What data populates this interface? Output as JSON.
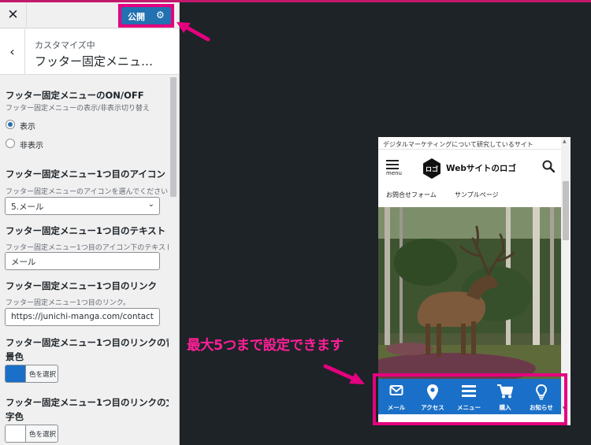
{
  "header": {
    "close_icon": "close-icon",
    "publish_label": "公開",
    "publish_gear_icon": "gear-icon"
  },
  "title_bar": {
    "subtitle": "カスタマイズ中",
    "title": "フッター固定メニュ…"
  },
  "sections": {
    "onoff": {
      "title": "フッター固定メニューのON/OFF",
      "desc": "フッター固定メニューの表示/非表示切り替え",
      "options": [
        {
          "label": "表示",
          "checked": true
        },
        {
          "label": "非表示",
          "checked": false
        }
      ]
    },
    "icon": {
      "title": "フッター固定メニュー1つ目のアイコン",
      "desc": "フッター固定メニューのアイコンを選んでください",
      "value": "5.メール"
    },
    "text": {
      "title": "フッター固定メニュー1つ目のテキスト",
      "desc": "フッター固定メニュー1つ目のアイコン下のテキスト。",
      "value": "メール"
    },
    "link": {
      "title": "フッター固定メニュー1つ目のリンク",
      "desc": "フッター固定メニュー1つ目のリンク。",
      "value": "https://junichi-manga.com/contact"
    },
    "bg_color": {
      "title_line1": "フッター固定メニュー1つ目のリンクの背",
      "title_line2": "景色",
      "button_label": "色を選択",
      "color": "#1a70c8"
    },
    "text_color": {
      "title_line1": "フッター固定メニュー1つ目のリンクの文",
      "title_line2": "字色",
      "button_label": "色を選択",
      "color": "#ffffff"
    }
  },
  "preview": {
    "tagline": "デジタルマーケティングについて研究しているサイト",
    "menu_label": "menu",
    "logo_text": "Webサイトのロゴ",
    "logo_mark_text": "ロゴ",
    "nav": [
      "お問合せフォーム",
      "サンプルページ"
    ],
    "footer_menu": [
      {
        "label": "メール",
        "icon": "envelope-icon"
      },
      {
        "label": "アクセス",
        "icon": "map-pin-icon"
      },
      {
        "label": "メニュー",
        "icon": "hamburger-icon"
      },
      {
        "label": "購入",
        "icon": "cart-icon"
      },
      {
        "label": "お知らせ",
        "icon": "lightbulb-icon"
      }
    ],
    "footer_color": "#1a70c8"
  },
  "annotation": {
    "text": "最大5つまで設定できます",
    "color": "#e4007f"
  }
}
